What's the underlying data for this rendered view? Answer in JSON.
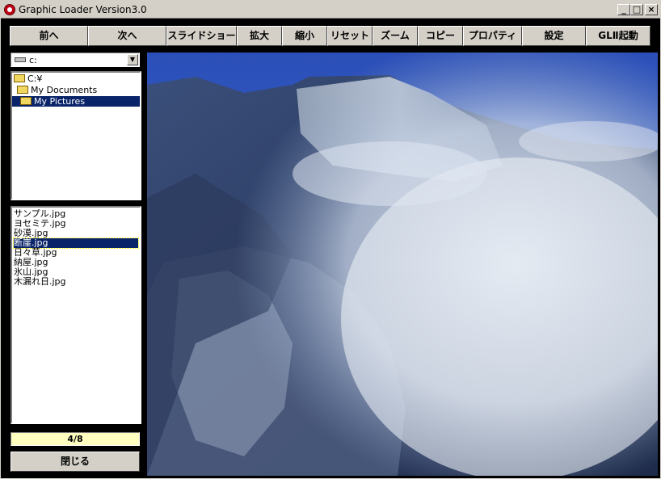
{
  "window": {
    "title": "Graphic Loader Version3.0",
    "min": "_",
    "max": "□",
    "close": "×"
  },
  "toolbar": {
    "prev": "前へ",
    "next": "次へ",
    "slideshow": "スライドショー",
    "zoom_in": "拡大",
    "zoom_out": "縮小",
    "reset": "リセット",
    "zoom": "ズーム",
    "copy": "コピー",
    "properties": "プロパティ",
    "settings": "設定",
    "launch": "GLⅡ起動"
  },
  "drive": {
    "value": "c:",
    "arrow": "▼"
  },
  "folders": [
    {
      "label": "C:¥"
    },
    {
      "label": "My Documents"
    },
    {
      "label": "My Pictures"
    }
  ],
  "files": [
    "サンプル.jpg",
    "ヨセミテ.jpg",
    "砂漠.jpg",
    "断崖.jpg",
    "日々草.jpg",
    "納屋.jpg",
    "氷山.jpg",
    "木漏れ日.jpg"
  ],
  "selected_file_index": 3,
  "counter": "4/8",
  "close_label": "閉じる",
  "colors": {
    "selection": "#0a246a",
    "counter_bg": "#ffffc0",
    "face": "#d4d0c8"
  }
}
